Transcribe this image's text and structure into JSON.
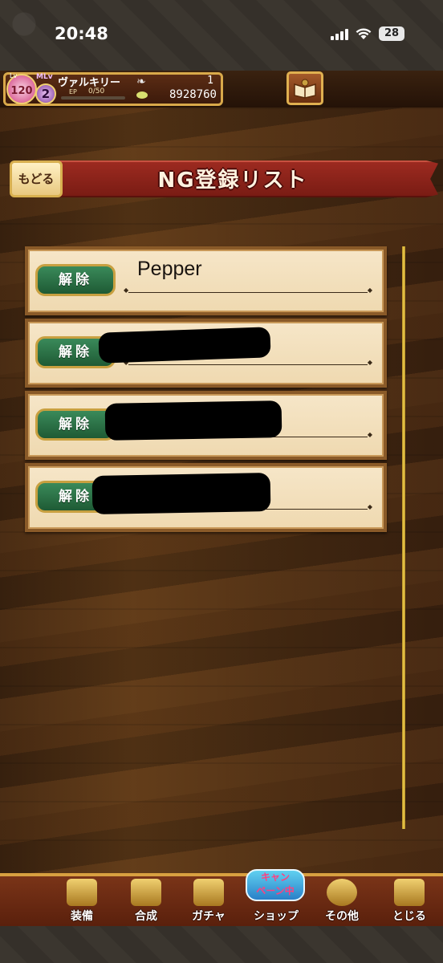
{
  "status_bar": {
    "time": "20:48",
    "battery": "28"
  },
  "header": {
    "lv_tag": "Lv",
    "level": "120",
    "mlv_tag": "MLv",
    "mlevel": "2",
    "player_name": "ヴァルキリー",
    "ep_label": "EP",
    "ep_value": "0/50",
    "ep_progress": 0,
    "feather_count": "1",
    "gold_count": "8928760"
  },
  "page": {
    "back_label": "もどる",
    "title": "NG登録リスト"
  },
  "rows": [
    {
      "button_label": "解除",
      "name": "Pepper",
      "redacted": false
    },
    {
      "button_label": "解除",
      "name": "",
      "redacted": true
    },
    {
      "button_label": "解除",
      "name": "",
      "redacted": true
    },
    {
      "button_label": "解除",
      "name": "",
      "redacted": true
    }
  ],
  "bottom_menu": {
    "campaign_badge": "キャン\nペーン中",
    "items": [
      {
        "label": "装備",
        "icon": "equipment-icon"
      },
      {
        "label": "合成",
        "icon": "hammer-icon"
      },
      {
        "label": "ガチャ",
        "icon": "gacha-icon"
      },
      {
        "label": "ショップ",
        "icon": "shop-icon"
      },
      {
        "label": "その他",
        "icon": "gears-icon"
      },
      {
        "label": "とじる",
        "icon": "close-icon"
      }
    ]
  }
}
